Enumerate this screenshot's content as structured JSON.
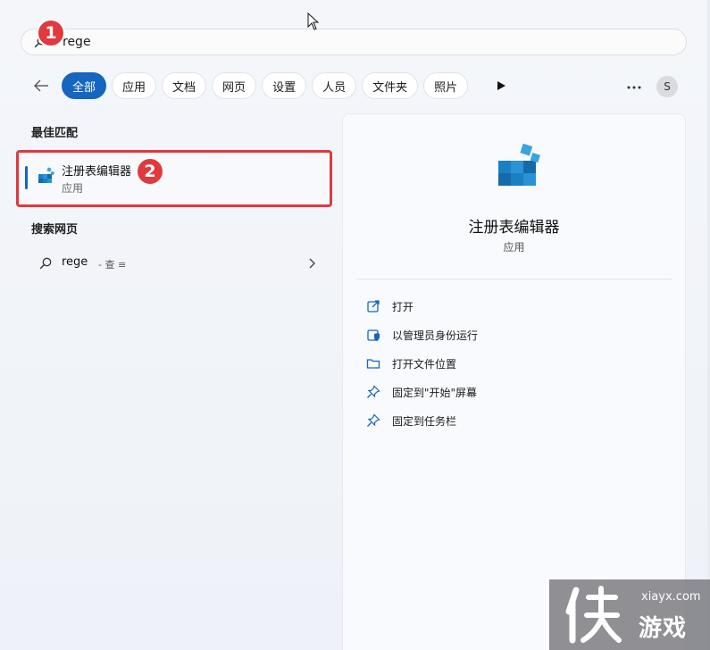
{
  "search": {
    "query": "rege"
  },
  "filters": {
    "items": [
      "全部",
      "应用",
      "文档",
      "网页",
      "设置",
      "人员",
      "文件夹",
      "照片"
    ],
    "active_index": 0
  },
  "account": {
    "initial": "S"
  },
  "left": {
    "best_match_title": "最佳匹配",
    "best_match": {
      "name": "注册表编辑器",
      "type": "应用"
    },
    "web_title": "搜索网页",
    "web_item": {
      "term": "rege",
      "suffix": "- 查 ≡"
    }
  },
  "detail": {
    "name": "注册表编辑器",
    "type": "应用",
    "actions": [
      {
        "label": "打开",
        "icon": "open-icon"
      },
      {
        "label": "以管理员身份运行",
        "icon": "admin-shield-icon"
      },
      {
        "label": "打开文件位置",
        "icon": "folder-icon"
      },
      {
        "label": "固定到\"开始\"屏幕",
        "icon": "pin-icon"
      },
      {
        "label": "固定到任务栏",
        "icon": "pin-icon"
      }
    ]
  },
  "badges": {
    "step1": "1",
    "step2": "2"
  },
  "watermark": {
    "domain": "xiayx.com",
    "name": "游戏"
  },
  "colors": {
    "accent": "#1665c0",
    "highlight": "#e0393e"
  }
}
